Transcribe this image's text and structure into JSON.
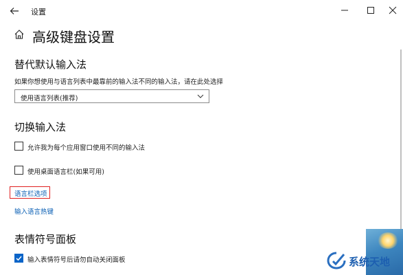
{
  "window": {
    "title": "设置",
    "controls": {
      "minimize": "minimize-icon",
      "maximize": "maximize-icon",
      "close": "close-icon"
    }
  },
  "page": {
    "title": "高级键盘设置",
    "icon": "home-icon"
  },
  "override_default": {
    "heading": "替代默认输入法",
    "description": "如果你想使用与语言列表中最靠前的输入法不同的输入法，请在此处选择",
    "dropdown_value": "使用语言列表(推荐)"
  },
  "switch_input": {
    "heading": "切换输入法",
    "options": [
      {
        "label": "允许我为每个应用窗口使用不同的输入法",
        "checked": false
      },
      {
        "label": "使用桌面语言栏(如果可用)",
        "checked": false
      }
    ],
    "links": [
      "语言栏选项",
      "输入语言热键"
    ]
  },
  "emoji_panel": {
    "heading": "表情符号面板",
    "option": {
      "label": "输入表情符号后请勿自动关闭面板",
      "checked": true
    }
  },
  "watermark": {
    "text": "系统天地"
  },
  "colors": {
    "accent": "#0a64c8",
    "link": "#0a5fb4",
    "highlight": "#e02020"
  }
}
